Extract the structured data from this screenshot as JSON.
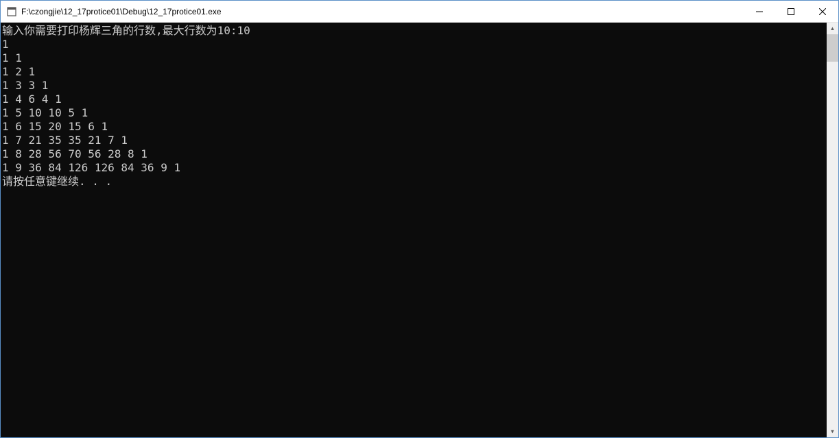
{
  "window": {
    "title": "F:\\czongjie\\12_17protice01\\Debug\\12_17protice01.exe"
  },
  "console": {
    "prompt_line": "输入你需要打印杨辉三角的行数,最大行数为10:10",
    "triangle_rows": [
      "1",
      "1 1",
      "1 2 1",
      "1 3 3 1",
      "1 4 6 4 1",
      "1 5 10 10 5 1",
      "1 6 15 20 15 6 1",
      "1 7 21 35 35 21 7 1",
      "1 8 28 56 70 56 28 8 1",
      "1 9 36 84 126 126 84 36 9 1"
    ],
    "continue_prompt": "请按任意键继续. . ."
  }
}
